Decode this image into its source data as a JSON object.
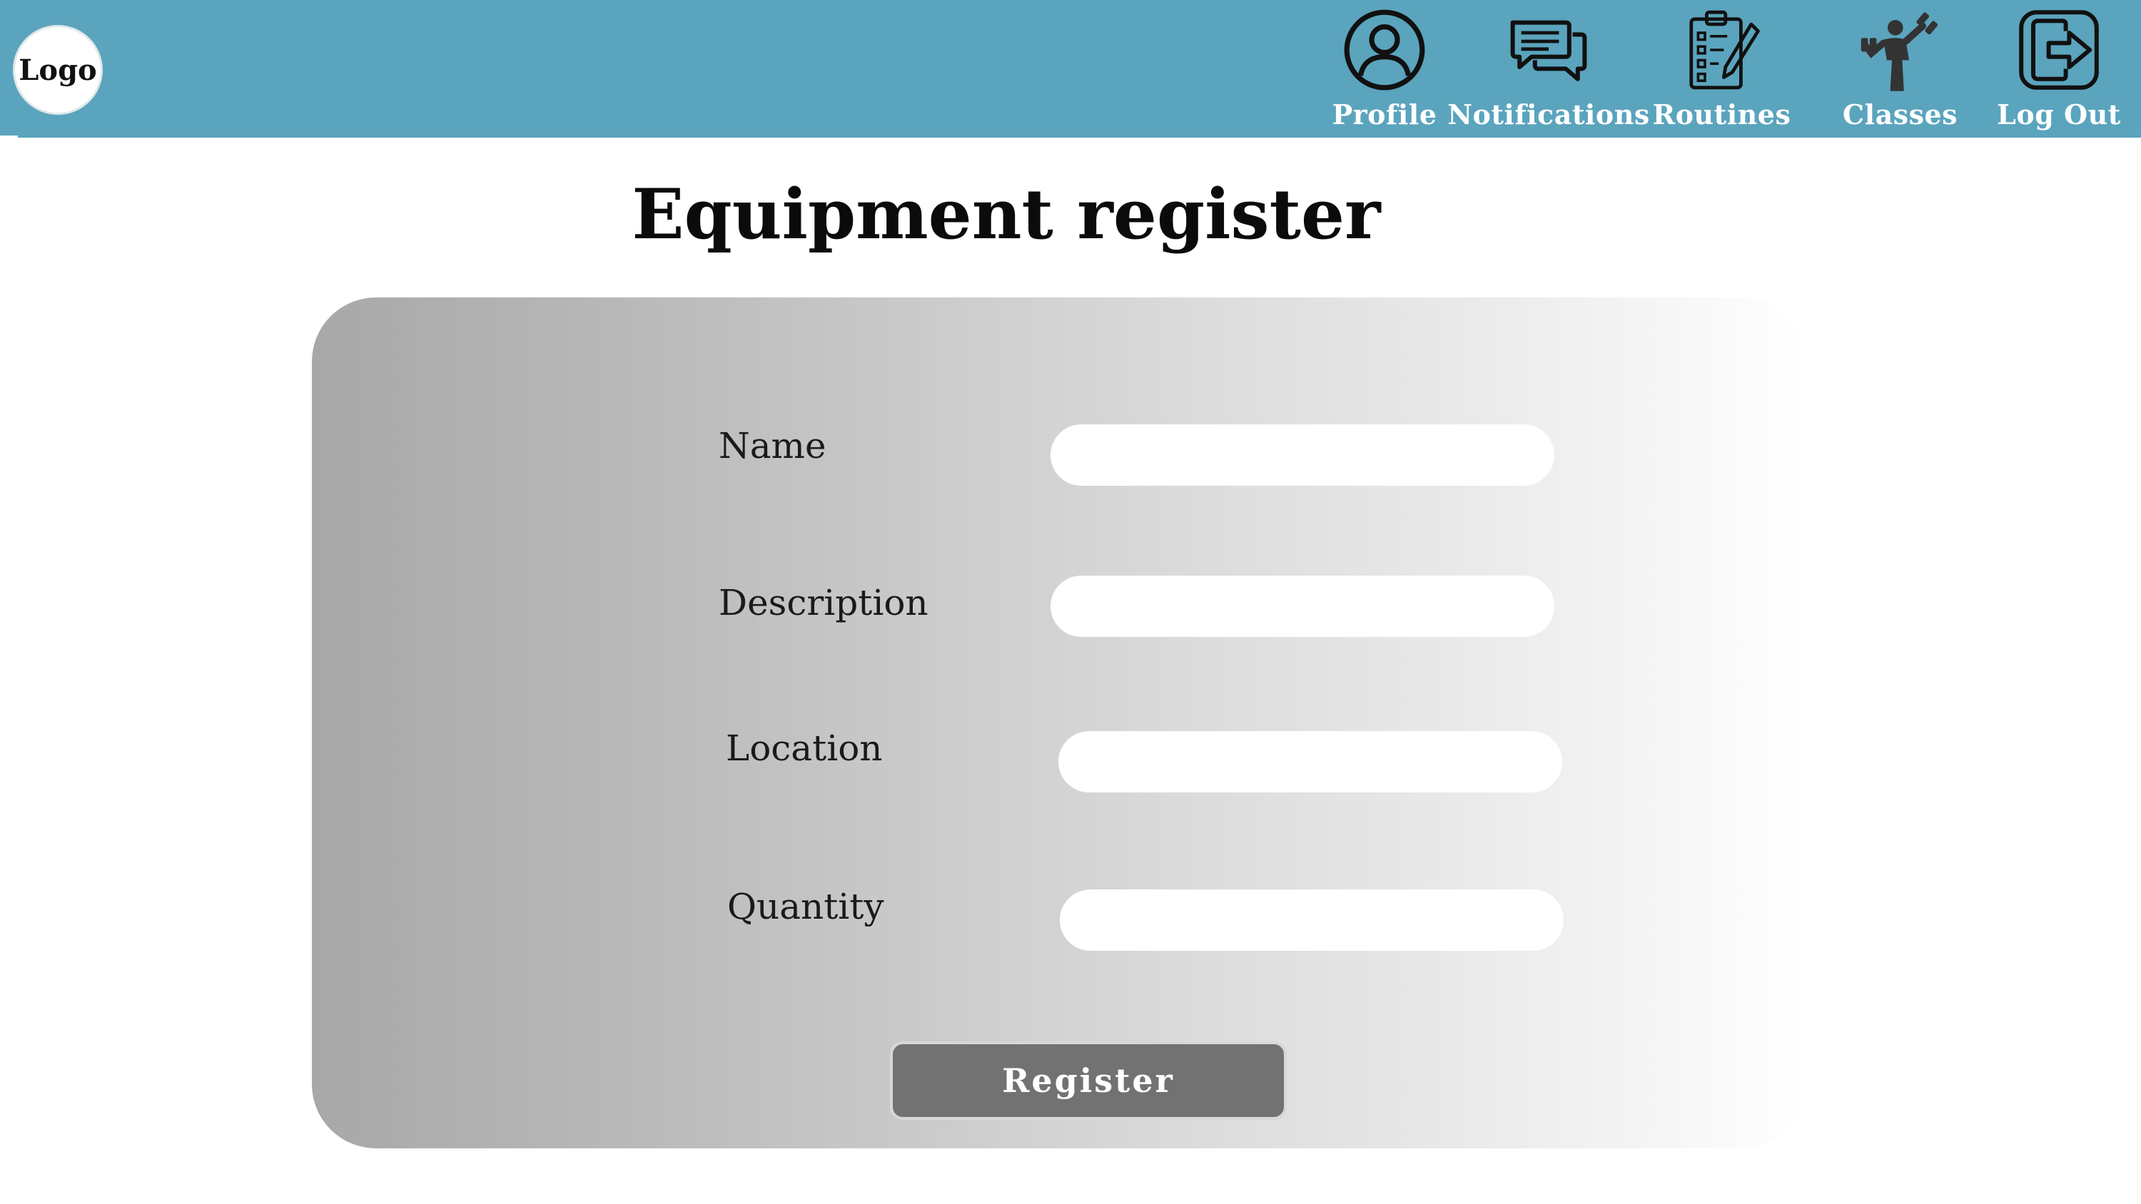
{
  "header": {
    "logo_text": "Logo",
    "background_color": "#5ba4bd",
    "nav": [
      {
        "label": "Profile",
        "icon": "user-icon"
      },
      {
        "label": "Notifications",
        "icon": "chat-bubbles-icon"
      },
      {
        "label": "Routines",
        "icon": "clipboard-checklist-icon"
      },
      {
        "label": "Classes",
        "icon": "weightlifter-icon"
      },
      {
        "label": "Log Out",
        "icon": "logout-icon"
      }
    ]
  },
  "page": {
    "title": "Equipment register"
  },
  "form": {
    "fields": [
      {
        "label": "Name",
        "value": "",
        "placeholder": ""
      },
      {
        "label": "Description",
        "value": "",
        "placeholder": ""
      },
      {
        "label": "Location",
        "value": "",
        "placeholder": ""
      },
      {
        "label": "Quantity",
        "value": "",
        "placeholder": ""
      }
    ],
    "submit_label": "Register",
    "submit_color": "#727272"
  }
}
